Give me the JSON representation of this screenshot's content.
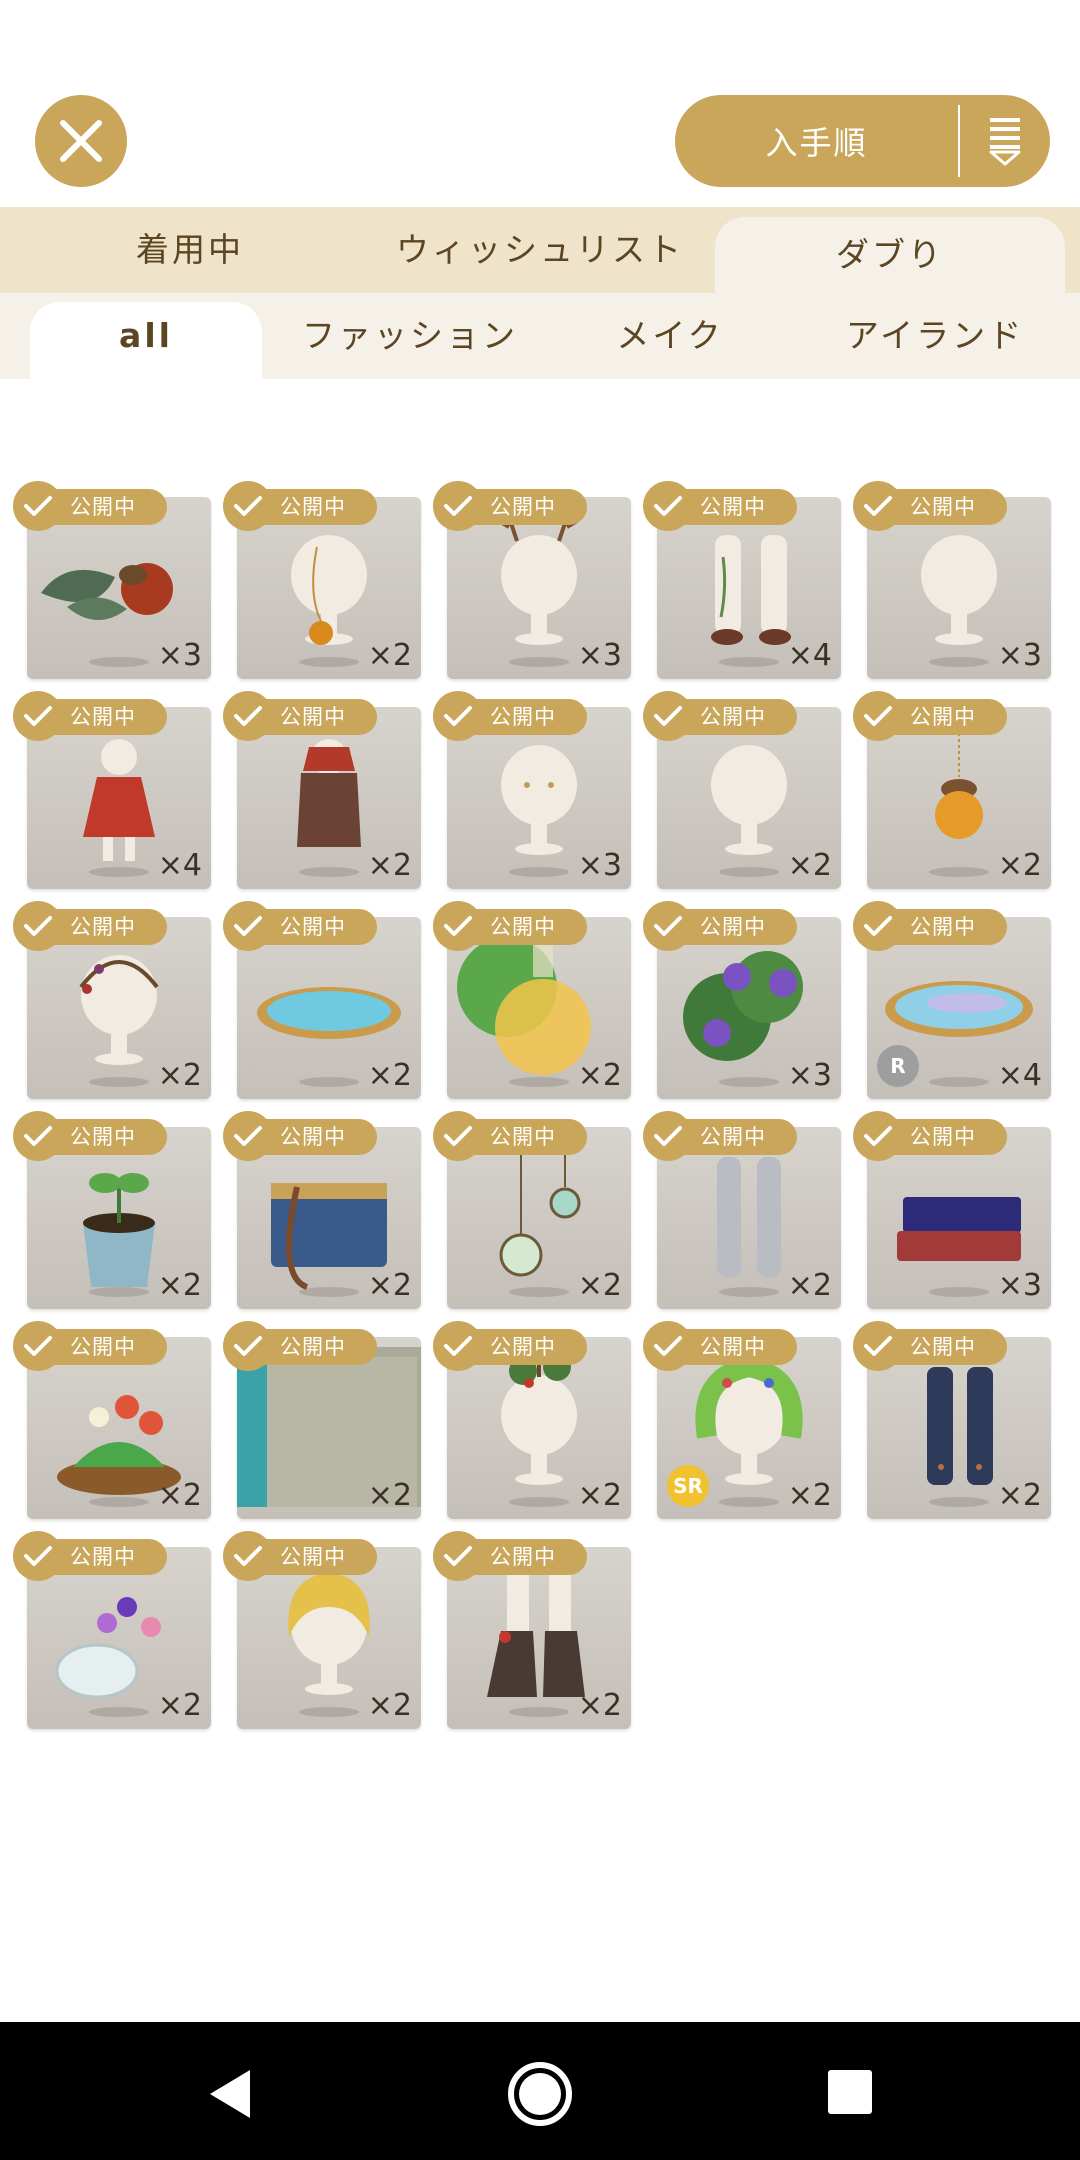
{
  "header": {
    "sort_label": "入手順"
  },
  "primary_tabs": [
    {
      "label": "着用中",
      "active": false
    },
    {
      "label": "ウィッシュリスト",
      "active": false
    },
    {
      "label": "ダブり",
      "active": true
    }
  ],
  "secondary_tabs": [
    {
      "label": "all",
      "active": true
    },
    {
      "label": "ファッション",
      "active": false
    },
    {
      "label": "メイク",
      "active": false
    },
    {
      "label": "アイランド",
      "active": false
    }
  ],
  "public_badge": "公開中",
  "items": [
    {
      "icon": "acorn-leaf-icon",
      "count": "×3"
    },
    {
      "icon": "acorn-necklace-icon",
      "count": "×2"
    },
    {
      "icon": "antler-head-icon",
      "count": "×3"
    },
    {
      "icon": "leaf-stockings-icon",
      "count": "×4"
    },
    {
      "icon": "face-makeup-icon",
      "count": "×3"
    },
    {
      "icon": "red-dress-icon",
      "count": "×4"
    },
    {
      "icon": "brown-outfit-icon",
      "count": "×2"
    },
    {
      "icon": "eyes-makeup-icon",
      "count": "×3"
    },
    {
      "icon": "mouth-makeup-icon",
      "count": "×2"
    },
    {
      "icon": "acorn-lantern-icon",
      "count": "×2"
    },
    {
      "icon": "berry-headband-icon",
      "count": "×2"
    },
    {
      "icon": "pond-icon",
      "count": "×2"
    },
    {
      "icon": "potion-flask-icon",
      "count": "×2"
    },
    {
      "icon": "hydrangea-bush-icon",
      "count": "×3"
    },
    {
      "icon": "rainbow-pond-icon",
      "count": "×4",
      "rarity": "R"
    },
    {
      "icon": "sprout-pot-icon",
      "count": "×2"
    },
    {
      "icon": "book-bag-icon",
      "count": "×2"
    },
    {
      "icon": "terrarium-pendant-icon",
      "count": "×2"
    },
    {
      "icon": "gray-tights-icon",
      "count": "×2"
    },
    {
      "icon": "book-stack-icon",
      "count": "×3"
    },
    {
      "icon": "flower-basket-icon",
      "count": "×2"
    },
    {
      "icon": "open-book-icon",
      "count": "×2"
    },
    {
      "icon": "bird-tree-hair-icon",
      "count": "×2"
    },
    {
      "icon": "flower-wreath-hair-icon",
      "count": "×2",
      "rarity": "SR"
    },
    {
      "icon": "navy-socks-icon",
      "count": "×2"
    },
    {
      "icon": "flower-vase-icon",
      "count": "×2"
    },
    {
      "icon": "blonde-hair-icon",
      "count": "×2"
    },
    {
      "icon": "lace-up-boots-icon",
      "count": "×2"
    }
  ],
  "colors": {
    "accent": "#c9a65a",
    "tab_bar": "#efe3c9",
    "tab_active": "#f6f1e8",
    "text_brown": "#5b4523",
    "rarity_R": "#9e9e9e",
    "rarity_SR": "#f2c12e"
  }
}
